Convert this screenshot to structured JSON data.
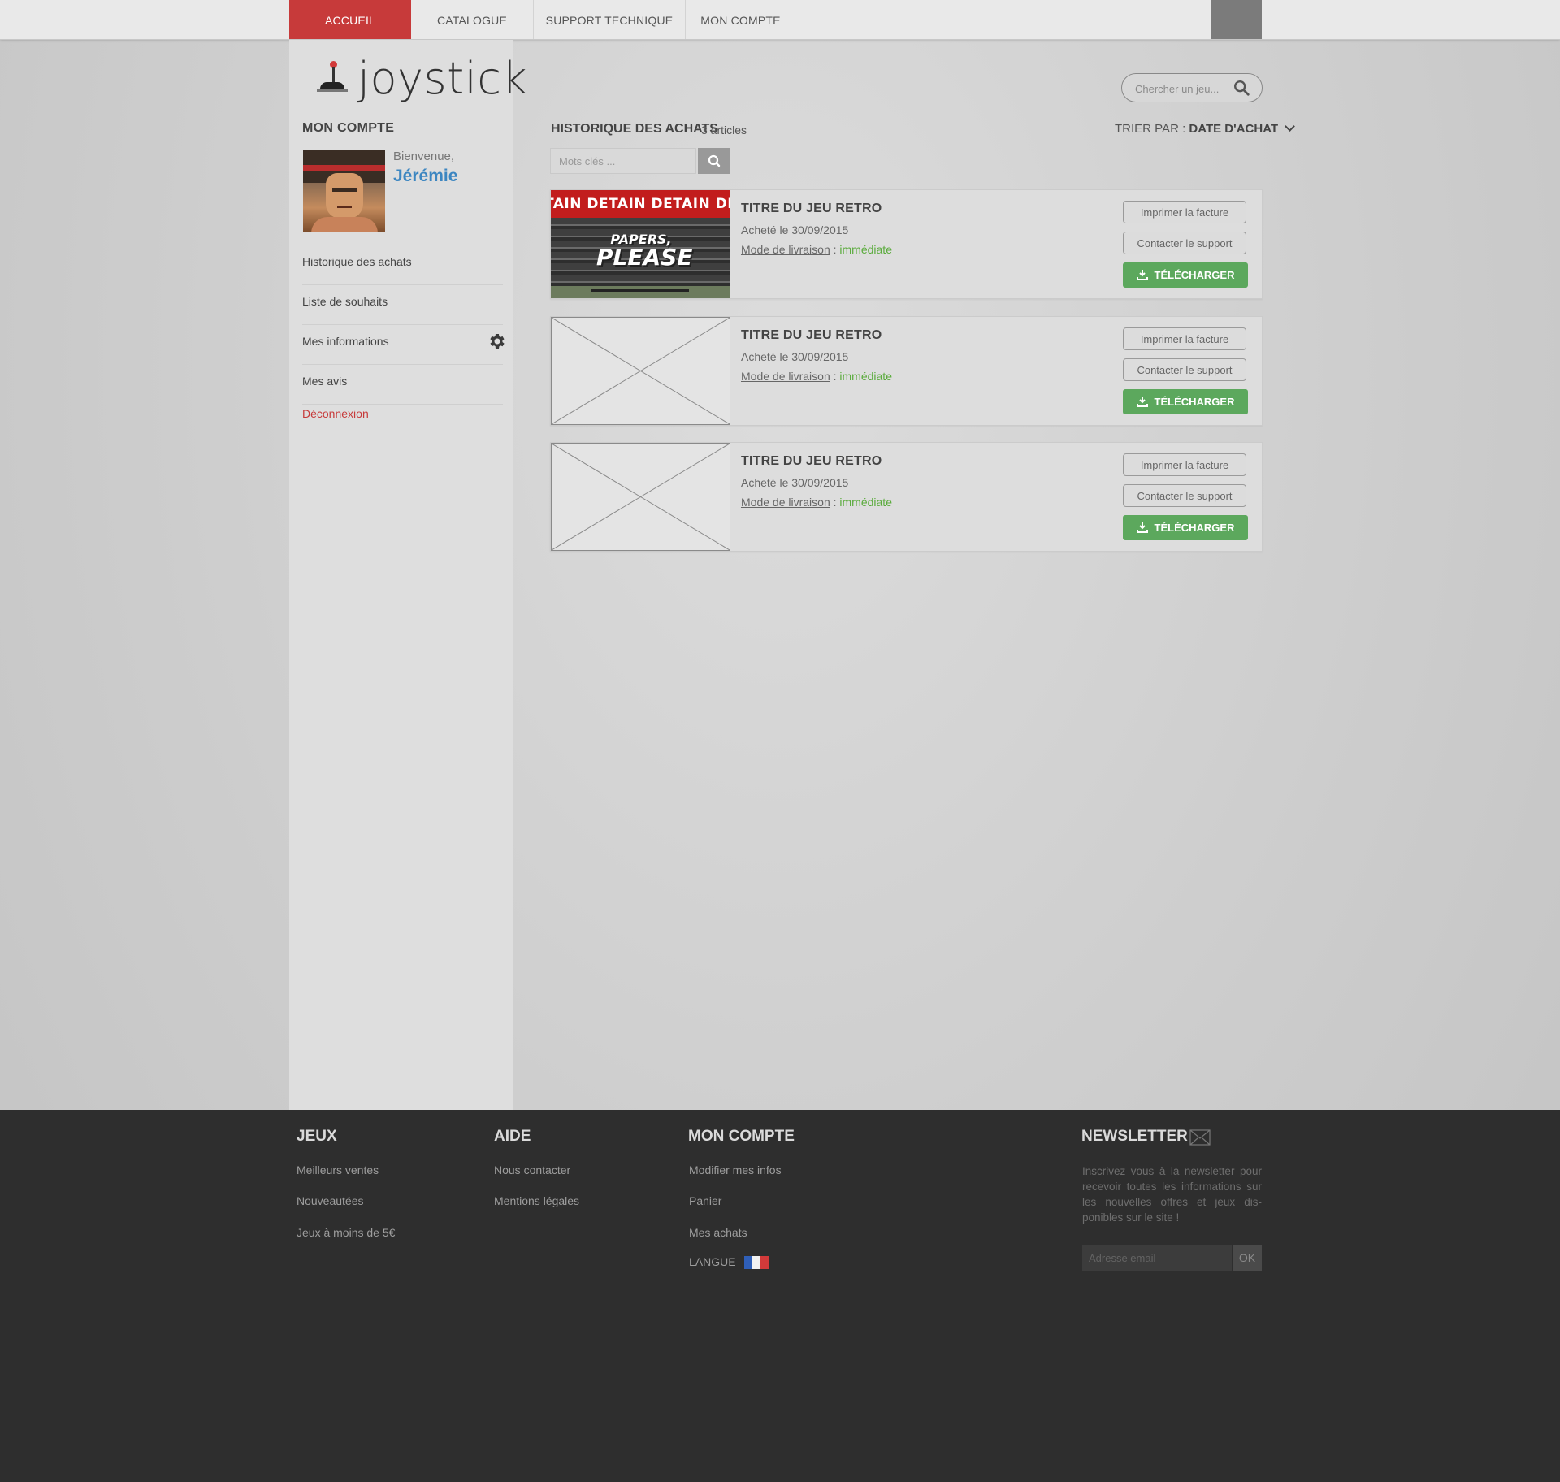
{
  "nav": {
    "tabs": [
      {
        "label": "ACCUEIL",
        "active": true
      },
      {
        "label": "CATALOGUE",
        "active": false
      },
      {
        "label": "SUPPORT TECHNIQUE",
        "active": false
      },
      {
        "label": "MON COMPTE",
        "active": false
      }
    ]
  },
  "brand": {
    "name": "joystick",
    "icon": "joystick-icon"
  },
  "sidebar": {
    "title": "MON COMPTE",
    "welcome": "Bienvenue,",
    "username": "Jérémie",
    "items": [
      {
        "label": "Historique des achats"
      },
      {
        "label": "Liste de souhaits"
      },
      {
        "label": "Mes informations",
        "icon": "gear-icon"
      },
      {
        "label": "Mes avis"
      }
    ],
    "logout": "Déconnexion"
  },
  "search": {
    "placeholder": "Chercher un jeu...",
    "icon": "search-icon"
  },
  "main": {
    "title": "HISTORIQUE DES ACHATS",
    "count": "3 articles",
    "sort_label": "TRIER PAR :",
    "sort_value": "DATE D'ACHAT",
    "keywords_placeholder": "Mots clés ...",
    "purchases": [
      {
        "image": "papers-please",
        "banner_text": "TAIN DETAIN DETAIN DET",
        "logo_line1": "PAPERS,",
        "logo_line2": "PLEASE",
        "title": "TITRE DU JEU RETRO",
        "bought": "Acheté le 30/09/2015",
        "delivery_label": "Mode de livraison",
        "delivery_sep": " : ",
        "delivery_value": "immédiate",
        "print_label": "Imprimer la facture",
        "support_label": "Contacter le support",
        "download_label": "TÉLÉCHARGER"
      },
      {
        "image": "placeholder",
        "title": "TITRE DU JEU RETRO",
        "bought": "Acheté le 30/09/2015",
        "delivery_label": "Mode de livraison",
        "delivery_sep": " : ",
        "delivery_value": "immédiate",
        "print_label": "Imprimer la facture",
        "support_label": "Contacter le support",
        "download_label": "TÉLÉCHARGER"
      },
      {
        "image": "placeholder",
        "title": "TITRE DU JEU RETRO",
        "bought": "Acheté le 30/09/2015",
        "delivery_label": "Mode de livraison",
        "delivery_sep": " : ",
        "delivery_value": "immédiate",
        "print_label": "Imprimer la facture",
        "support_label": "Contacter le support",
        "download_label": "TÉLÉCHARGER"
      }
    ]
  },
  "footer": {
    "jeux": {
      "title": "JEUX",
      "links": [
        "Meilleurs ventes",
        "Nouveautées",
        "Jeux à moins de 5€"
      ]
    },
    "aide": {
      "title": "AIDE",
      "links": [
        "Nous contacter",
        "Mentions légales"
      ]
    },
    "compte": {
      "title": "MON COMPTE",
      "links": [
        "Modifier mes infos",
        "Panier",
        "Mes achats"
      ]
    },
    "langue": "LANGUE",
    "newsletter": {
      "title": "NEWSLETTER",
      "text": "Inscrivez vous à la newsletter pour recevoir toutes les informations sur les nouvelles offres et jeux dis-ponibles sur le site !",
      "placeholder": "Adresse email",
      "ok": "OK"
    }
  },
  "colors": {
    "accent": "#c73a3a",
    "download": "#5ca85d",
    "link_blue": "#3c86c1",
    "delivery_green": "#5aab3c"
  }
}
